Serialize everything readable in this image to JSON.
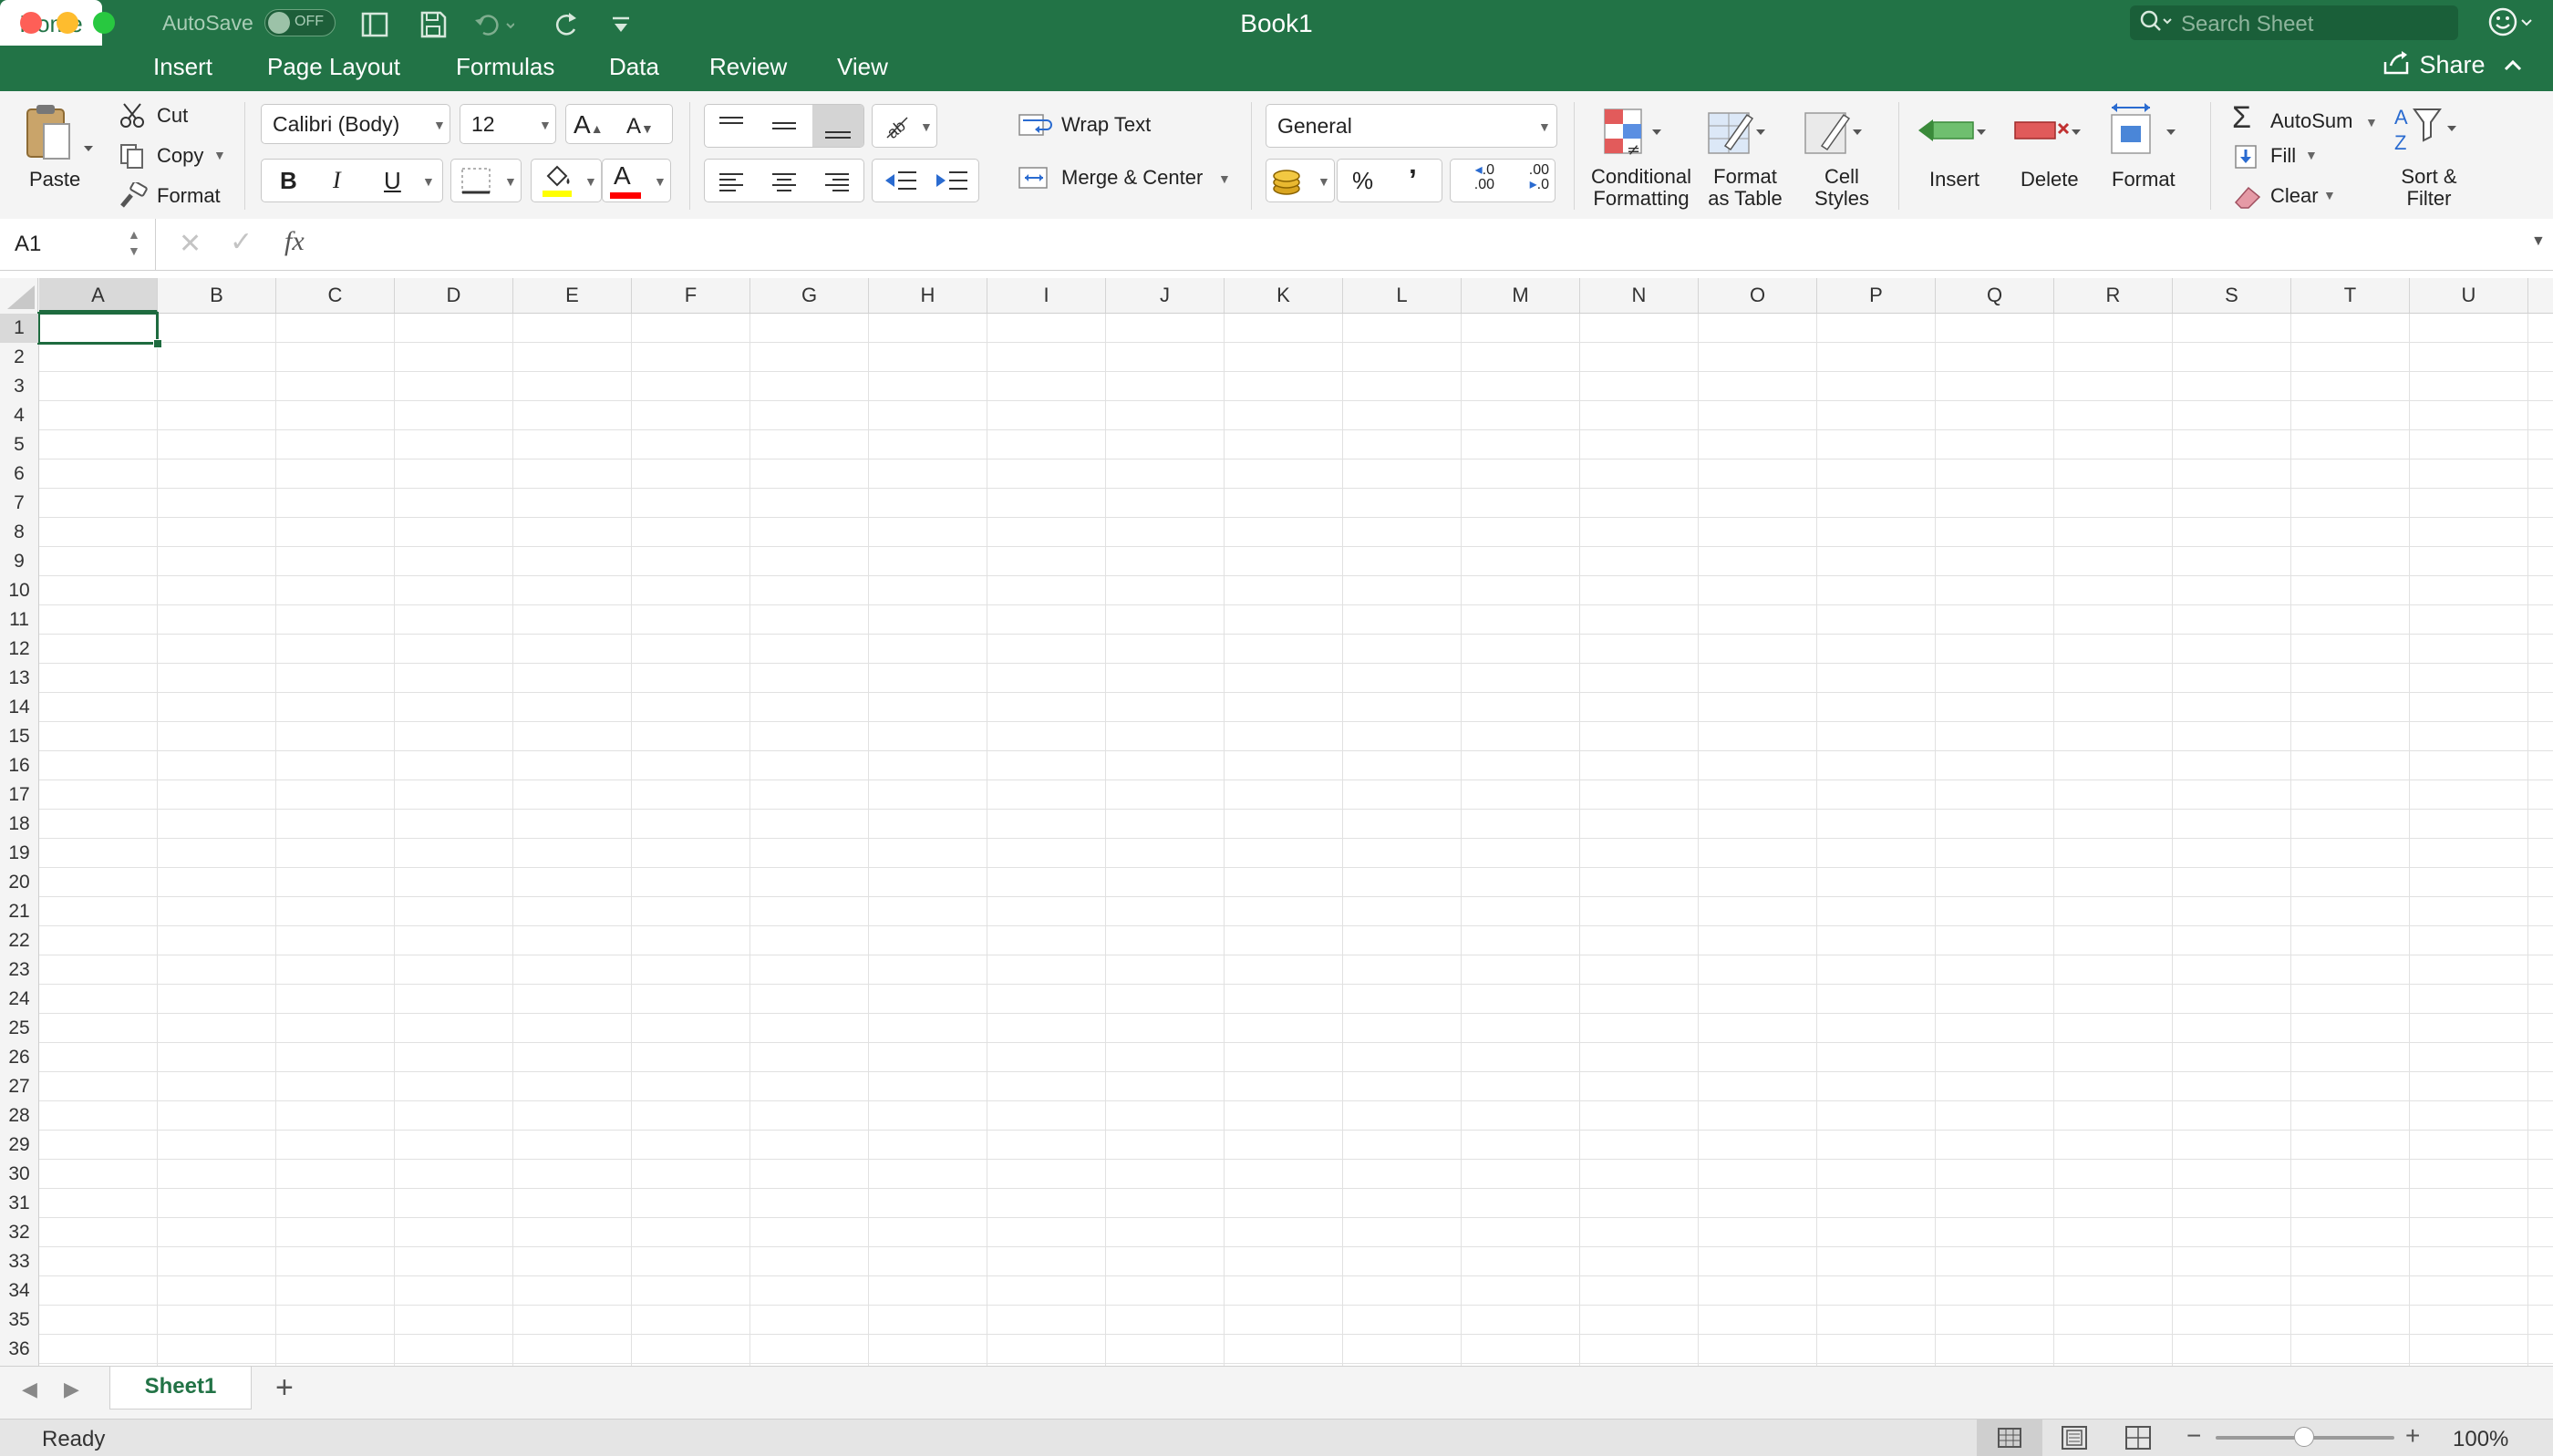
{
  "window": {
    "title": "Book1",
    "autosave_label": "AutoSave",
    "autosave_state": "OFF",
    "search_placeholder": "Search Sheet"
  },
  "tabs": [
    "Home",
    "Insert",
    "Page Layout",
    "Formulas",
    "Data",
    "Review",
    "View"
  ],
  "share_label": "Share",
  "ribbon": {
    "clipboard": {
      "paste": "Paste",
      "cut": "Cut",
      "copy": "Copy",
      "format": "Format"
    },
    "font": {
      "name": "Calibri (Body)",
      "size": "12",
      "bold": "B",
      "italic": "I",
      "underline": "U",
      "grow": "A",
      "shrink": "A",
      "font_color_glyph": "A"
    },
    "alignment": {
      "wrap_text": "Wrap Text",
      "merge_center": "Merge & Center"
    },
    "number": {
      "format": "General",
      "percent": "%",
      "comma": "ʼ",
      "inc_decimal_top": ".0",
      "inc_decimal_bottom": ".00",
      "dec_decimal_top": ".00",
      "dec_decimal_bottom": ".0"
    },
    "styles": {
      "conditional_1": "Conditional",
      "conditional_2": "Formatting",
      "table_1": "Format",
      "table_2": "as Table",
      "cell_1": "Cell",
      "cell_2": "Styles"
    },
    "cells": {
      "insert": "Insert",
      "delete": "Delete",
      "format": "Format"
    },
    "editing": {
      "autosum": "AutoSum",
      "fill": "Fill",
      "clear": "Clear",
      "sort_1": "Sort &",
      "sort_2": "Filter"
    }
  },
  "formula_bar": {
    "name_box": "A1",
    "fx": "fx",
    "formula": ""
  },
  "columns": [
    "A",
    "B",
    "C",
    "D",
    "E",
    "F",
    "G",
    "H",
    "I",
    "J",
    "K",
    "L",
    "M",
    "N",
    "O",
    "P",
    "Q",
    "R",
    "S",
    "T",
    "U"
  ],
  "rows": [
    "1",
    "2",
    "3",
    "4",
    "5",
    "6",
    "7",
    "8",
    "9",
    "10",
    "11",
    "12",
    "13",
    "14",
    "15",
    "16",
    "17",
    "18",
    "19",
    "20",
    "21",
    "22",
    "23",
    "24",
    "25",
    "26",
    "27",
    "28",
    "29",
    "30",
    "31",
    "32",
    "33",
    "34",
    "35",
    "36"
  ],
  "sheets": [
    "Sheet1"
  ],
  "status": {
    "text": "Ready",
    "zoom": "100%"
  },
  "colors": {
    "excel_green": "#227346",
    "selection": "#1e6b3f"
  }
}
